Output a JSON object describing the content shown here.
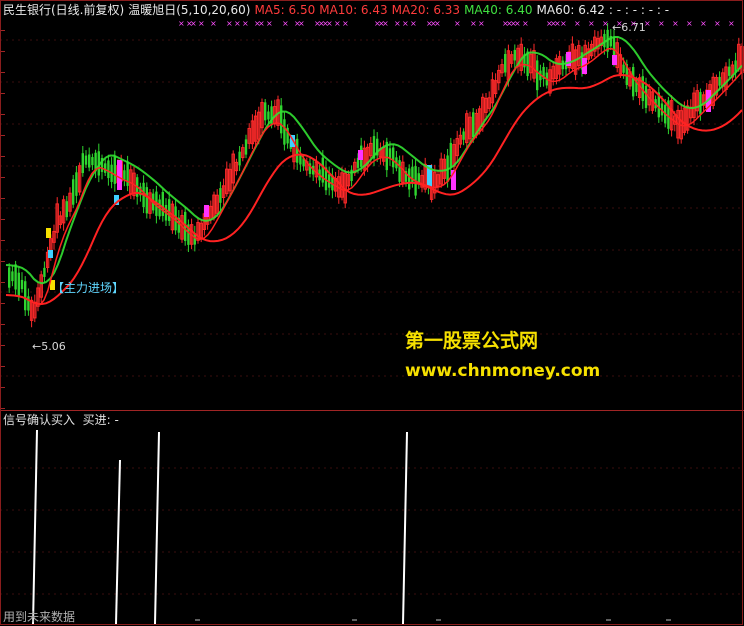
{
  "header": {
    "stock_name": "民生银行(日线.前复权)",
    "indicator_name": "温暖旭日(5,10,20,60)",
    "ma5": "MA5: 6.50",
    "ma10": "MA10: 6.43",
    "ma20": "MA20: 6.33",
    "ma40": "MA40: 6.40",
    "ma60": "MA60: 6.42",
    "extra": ": - : - : - : -"
  },
  "annotations": {
    "signal_label": "【主力进场】",
    "low_price": "←5.06",
    "high_price": "←6.71"
  },
  "watermark": {
    "title": "第一股票公式网",
    "url": "www.chnmoney.com"
  },
  "sub_panel": {
    "title": "信号确认买入",
    "buy_label": "买进: -"
  },
  "footer": {
    "note": "用到未来数据"
  },
  "colors": {
    "up": "#ff2a2a",
    "down": "#2fd52f",
    "ma_red": "#ff2222",
    "ma_green": "#32e032",
    "magenta": "#ff33ff",
    "cyan": "#3fd0ff",
    "yellow": "#f6e000",
    "grid": "#a02525"
  },
  "chart_data": {
    "type": "candlestick",
    "price_range": [
      5.0,
      6.8
    ],
    "low_marker": 5.06,
    "high_marker": 6.71,
    "buy_signal_count": 4
  }
}
